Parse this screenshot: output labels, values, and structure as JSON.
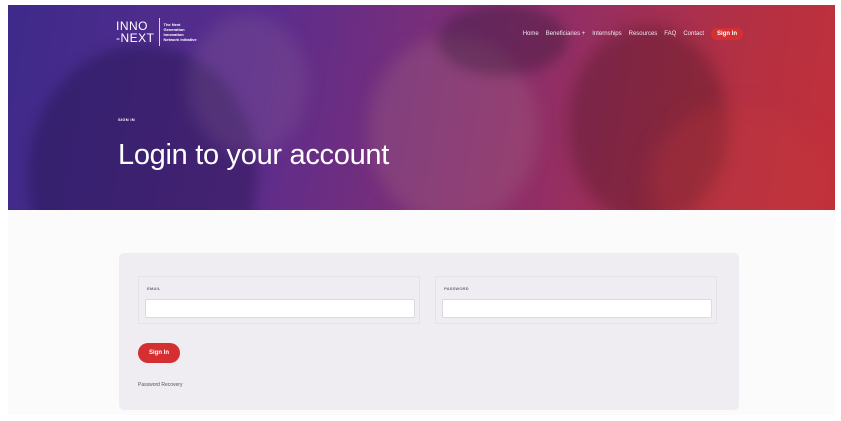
{
  "header": {
    "logo": {
      "word_top": "INNO",
      "word_bottom": "-NEXT",
      "tagline": [
        "The Next",
        "Generation",
        "Innovation",
        "Network Initiative"
      ]
    },
    "nav": [
      {
        "label": "Home"
      },
      {
        "label": "Beneficiaries +"
      },
      {
        "label": "Internships"
      },
      {
        "label": "Resources"
      },
      {
        "label": "FAQ"
      },
      {
        "label": "Contact"
      }
    ],
    "signin_label": "Sign In"
  },
  "hero": {
    "breadcrumb": "SIGN IN",
    "title": "Login to your account"
  },
  "form": {
    "email_label": "EMAIL",
    "email_value": "",
    "password_label": "PASSWORD",
    "password_value": "",
    "submit_label": "Sign In",
    "recover_label": "Password Recovery"
  },
  "colors": {
    "accent": "#d52f31",
    "hero_start": "#3d2a8a",
    "hero_end": "#c2303a",
    "card_bg": "#efedf2"
  }
}
